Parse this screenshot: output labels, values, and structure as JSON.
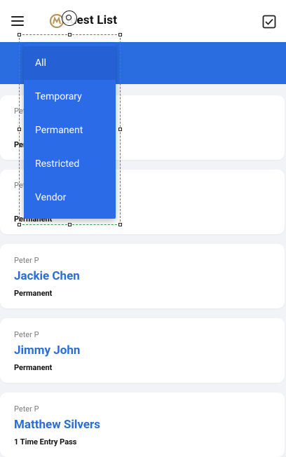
{
  "app": {
    "title": "Guest List"
  },
  "icons": {
    "menu": "hamburger-menu-icon",
    "logo": "app-logo-icon",
    "action": "checkbox-select-icon"
  },
  "colors": {
    "primary": "#2a6de1",
    "name_text": "#2a6dd8",
    "background": "#f1f3f6"
  },
  "filter_dropdown": {
    "selected": "All",
    "options": [
      "All",
      "Temporary",
      "Permanent",
      "Restricted",
      "Vendor"
    ]
  },
  "guests": [
    {
      "host": "Peter P",
      "name": "",
      "type": "Permanent"
    },
    {
      "host": "Peter P",
      "name": "",
      "type": "Permanent"
    },
    {
      "host": "Peter P",
      "name": "Jackie Chen",
      "type": "Permanent"
    },
    {
      "host": "Peter P",
      "name": "Jimmy John",
      "type": "Permanent"
    },
    {
      "host": "Peter P",
      "name": "Matthew Silvers",
      "type": "1 Time Entry Pass"
    }
  ]
}
